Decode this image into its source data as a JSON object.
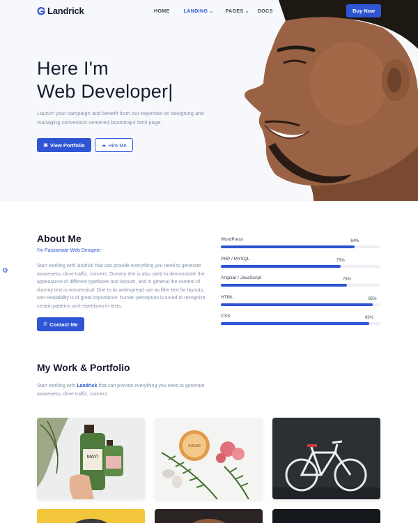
{
  "header": {
    "brand": "Landrick",
    "nav": [
      {
        "label": "HOME"
      },
      {
        "label": "LANDING",
        "caret": "⌄",
        "active": true
      },
      {
        "label": "PAGES",
        "caret": "⌄"
      },
      {
        "label": "DOCS"
      }
    ],
    "buy_label": "Buy Now"
  },
  "hero": {
    "title_line1": "Here I'm",
    "title_line2": "Web Developer|",
    "description": "Launch your campaign and benefit from our expertise on designing and managing conversion centered bootstrap4 html page.",
    "portfolio_btn": "View Portfolio",
    "hire_btn": "Hire Me"
  },
  "about": {
    "title": "About Me",
    "subtitle": "I'm Passionate Web Designer",
    "text": "Start working with landrick that can provide everything you need to generate awareness, drive traffic, connect. Dummy text is also used to demonstrate the appearance of different typefaces and layouts, and in general the content of dummy text is nonsensical. Due to its widespread use as filler text for layouts, non-readability is of great importance: human perception is tuned to recognize certain patterns and repetitions in texts.",
    "contact_btn": "Contact Me",
    "skills": [
      {
        "name": "WordPress",
        "percent": 84,
        "percent_label": "84%"
      },
      {
        "name": "PHP / MYSQL",
        "percent": 75,
        "percent_label": "75%"
      },
      {
        "name": "Angular / JavaScript",
        "percent": 79,
        "percent_label": "79%"
      },
      {
        "name": "HTML",
        "percent": 95,
        "percent_label": "95%"
      },
      {
        "name": "CSS",
        "percent": 93,
        "percent_label": "93%"
      }
    ]
  },
  "portfolio": {
    "title": "My Work & Portfolio",
    "desc_before": "Start working with ",
    "desc_brand": "Landrick",
    "desc_after": " that can provide everything you need to generate awareness, drive traffic, connect."
  },
  "colors": {
    "primary": "#2f55d4",
    "heading": "#161c2d",
    "muted": "#8492a6",
    "hero_bg": "#f7f8fc"
  }
}
